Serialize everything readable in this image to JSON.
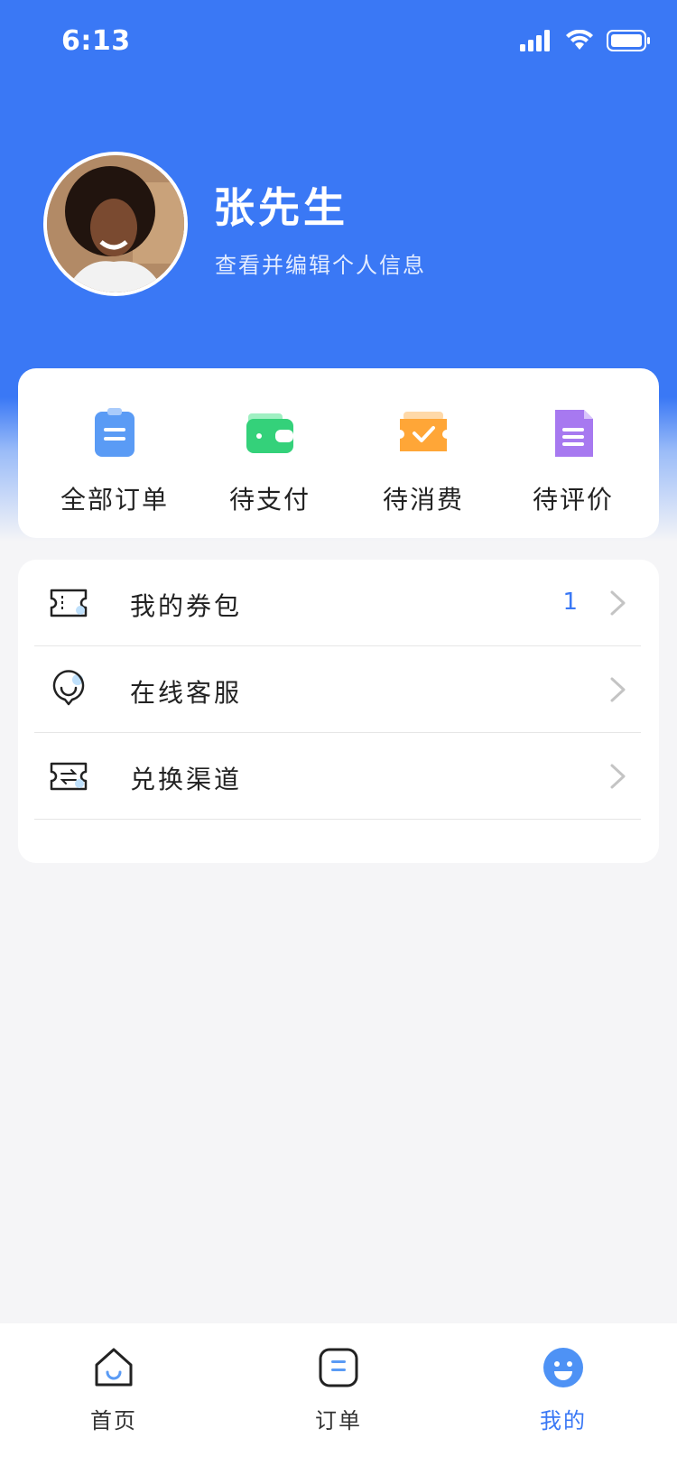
{
  "status_bar": {
    "time": "6:13"
  },
  "profile": {
    "name": "张先生",
    "subtitle": "查看并编辑个人信息"
  },
  "orders": [
    {
      "label": "全部订单",
      "icon": "clipboard-icon",
      "color": "#5a9bf5"
    },
    {
      "label": "待支付",
      "icon": "wallet-icon",
      "color": "#34d17a"
    },
    {
      "label": "待消费",
      "icon": "ticket-check-icon",
      "color": "#ffa637"
    },
    {
      "label": "待评价",
      "icon": "document-icon",
      "color": "#a779f0"
    }
  ],
  "menu": [
    {
      "label": "我的券包",
      "value": "1",
      "icon": "coupon-icon"
    },
    {
      "label": "在线客服",
      "value": "",
      "icon": "chat-service-icon"
    },
    {
      "label": "兑换渠道",
      "value": "",
      "icon": "exchange-ticket-icon"
    }
  ],
  "tabbar": [
    {
      "label": "首页",
      "icon": "home-icon"
    },
    {
      "label": "订单",
      "icon": "order-icon"
    },
    {
      "label": "我的",
      "icon": "smile-icon",
      "active": true
    }
  ],
  "colors": {
    "primary": "#3a78f5",
    "background": "#f5f5f7"
  }
}
